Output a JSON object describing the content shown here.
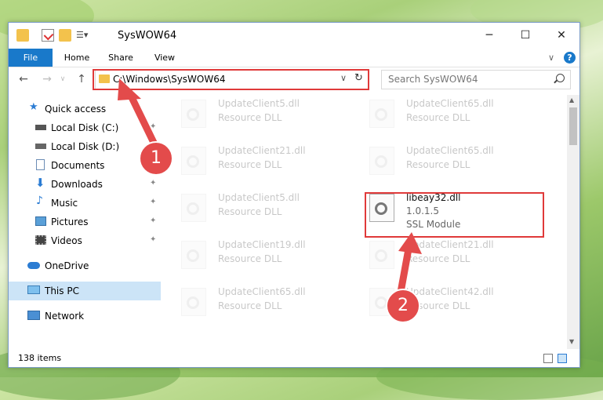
{
  "window": {
    "title": "SysWOW64",
    "controls": {
      "minimize": "─",
      "maximize": "☐",
      "close": "✕"
    }
  },
  "ribbon": {
    "tabs": [
      {
        "label": "File"
      },
      {
        "label": "Home"
      },
      {
        "label": "Share"
      },
      {
        "label": "View"
      }
    ],
    "collapse_glyph": "∨",
    "help_glyph": "?"
  },
  "address": {
    "path": "C:\\Windows\\SysWOW64",
    "search_placeholder": "Search SysWOW64"
  },
  "sidebar": {
    "items": [
      {
        "label": "Quick access",
        "icon": "star-icon"
      },
      {
        "label": "Local Disk (C:)",
        "icon": "drive-icon"
      },
      {
        "label": "Local Disk (D:)",
        "icon": "drive-icon"
      },
      {
        "label": "Documents",
        "icon": "documents-icon"
      },
      {
        "label": "Downloads",
        "icon": "download-icon"
      },
      {
        "label": "Music",
        "icon": "music-icon"
      },
      {
        "label": "Pictures",
        "icon": "pictures-icon"
      },
      {
        "label": "Videos",
        "icon": "videos-icon"
      },
      {
        "label": "OneDrive",
        "icon": "cloud-icon"
      },
      {
        "label": "This PC",
        "icon": "pc-icon"
      },
      {
        "label": "Network",
        "icon": "network-icon"
      }
    ]
  },
  "files": [
    {
      "name": "UpdateClient5.dll",
      "desc": "Resource DLL"
    },
    {
      "name": "UpdateClient65.dll",
      "desc": "Resource DLL"
    },
    {
      "name": "UpdateClient21.dll",
      "desc": "Resource DLL"
    },
    {
      "name": "UpdateClient65.dll",
      "desc": "Resource DLL"
    },
    {
      "name": "UpdateClient5.dll",
      "desc": "Resource DLL"
    },
    {
      "name": "libeay32.dll",
      "version": "1.0.1.5",
      "desc": "SSL Module"
    },
    {
      "name": "UpdateClient19.dll",
      "desc": "Resource DLL"
    },
    {
      "name": "UpdateClient21.dll",
      "desc": "Resource DLL"
    },
    {
      "name": "UpdateClient65.dll",
      "desc": "Resource DLL"
    },
    {
      "name": "UpdateClient42.dll",
      "desc": "Resource DLL"
    }
  ],
  "status": {
    "items": "138 items"
  },
  "steps": {
    "one": "1",
    "two": "2"
  },
  "colors": {
    "accent": "#1979ca",
    "highlight": "#e03a3a",
    "badge": "#e34b4b"
  }
}
